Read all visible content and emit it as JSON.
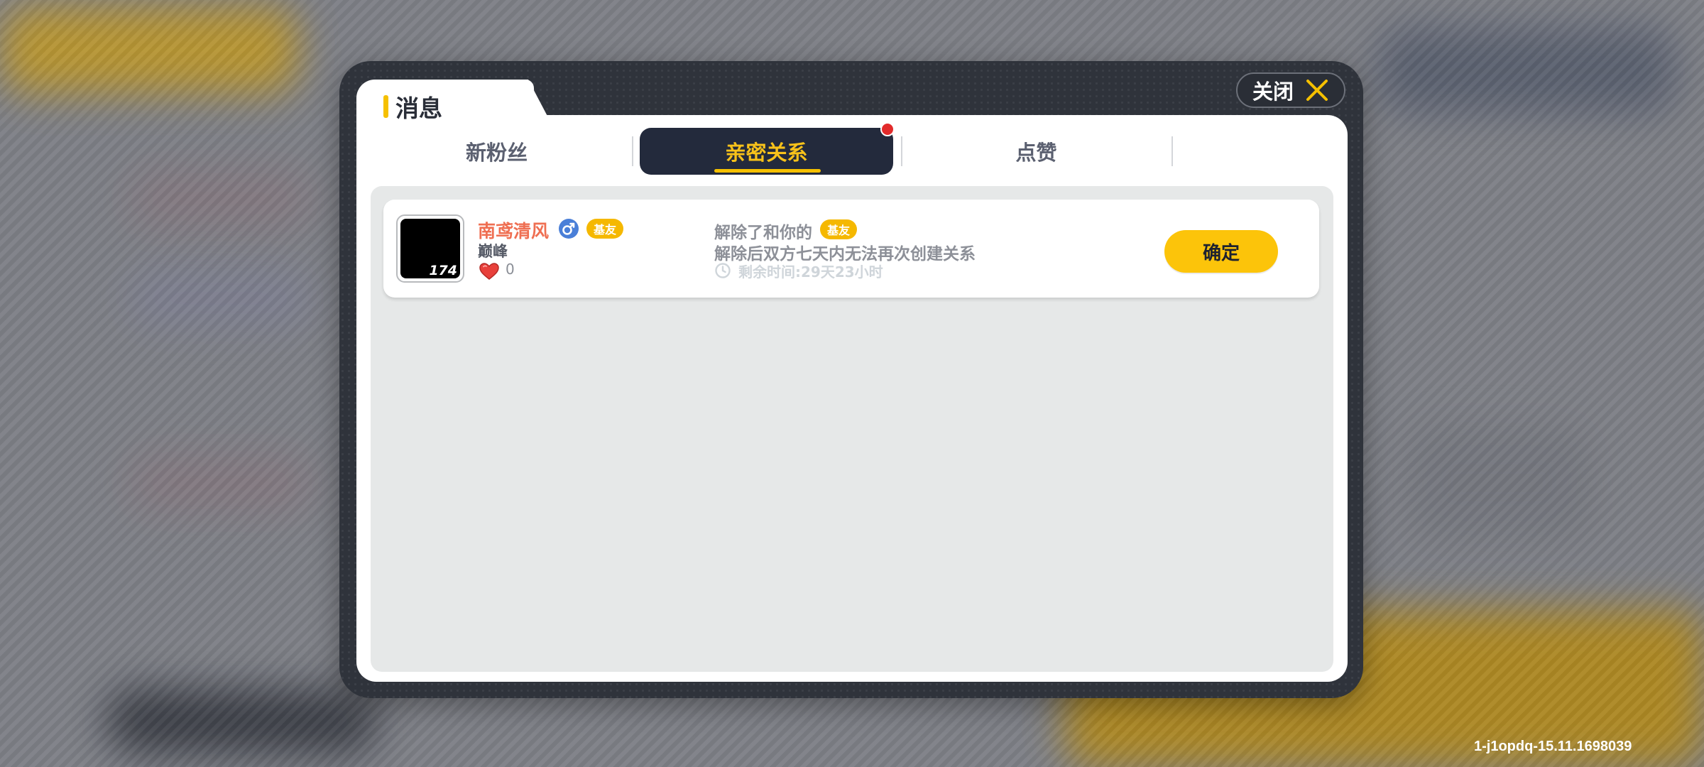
{
  "dialog": {
    "title": "消息",
    "close_label": "关闭"
  },
  "tabs": [
    {
      "label": "新粉丝",
      "active": false
    },
    {
      "label": "亲密关系",
      "active": true,
      "has_notification": true
    },
    {
      "label": "点赞",
      "active": false
    }
  ],
  "message": {
    "avatar_level": "174",
    "user_name": "南鸢清风",
    "gender": "male",
    "relation_badge": "基友",
    "rank": "巅峰",
    "likes": "0",
    "text_prefix": "解除了和你的",
    "relation_badge_inline": "基友",
    "text_line2": "解除后双方七天内无法再次创建关系",
    "remaining_time": "剩余时间:29天23小时",
    "confirm_label": "确定"
  },
  "footer": {
    "version": "1-j1opdq-15.11.1698039"
  },
  "colors": {
    "accent_yellow": "#f5c000",
    "tab_active_bg": "#232a3c",
    "name_color": "#ef6f52",
    "notification_red": "#e22b2b"
  }
}
